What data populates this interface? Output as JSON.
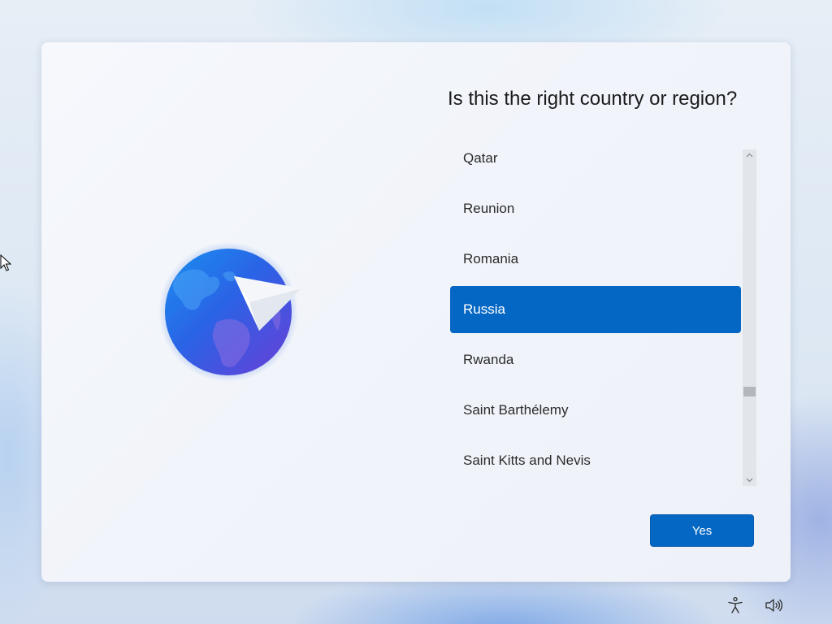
{
  "oobe": {
    "heading": "Is this the right country or region?",
    "countries": [
      {
        "label": "Qatar",
        "selected": false
      },
      {
        "label": "Reunion",
        "selected": false
      },
      {
        "label": "Romania",
        "selected": false
      },
      {
        "label": "Russia",
        "selected": true
      },
      {
        "label": "Rwanda",
        "selected": false
      },
      {
        "label": "Saint Barthélemy",
        "selected": false
      },
      {
        "label": "Saint Kitts and Nevis",
        "selected": false
      }
    ],
    "selected_country": "Russia",
    "yes_label": "Yes"
  },
  "colors": {
    "accent": "#0567c4",
    "scrollbar_track": "#e2e5ea",
    "scrollbar_thumb": "#b3b6bb"
  },
  "icons": {
    "illustration": "globe-with-paper-plane-icon",
    "accessibility": "accessibility-icon",
    "volume": "volume-icon",
    "pointer": "mouse-pointer-icon"
  }
}
